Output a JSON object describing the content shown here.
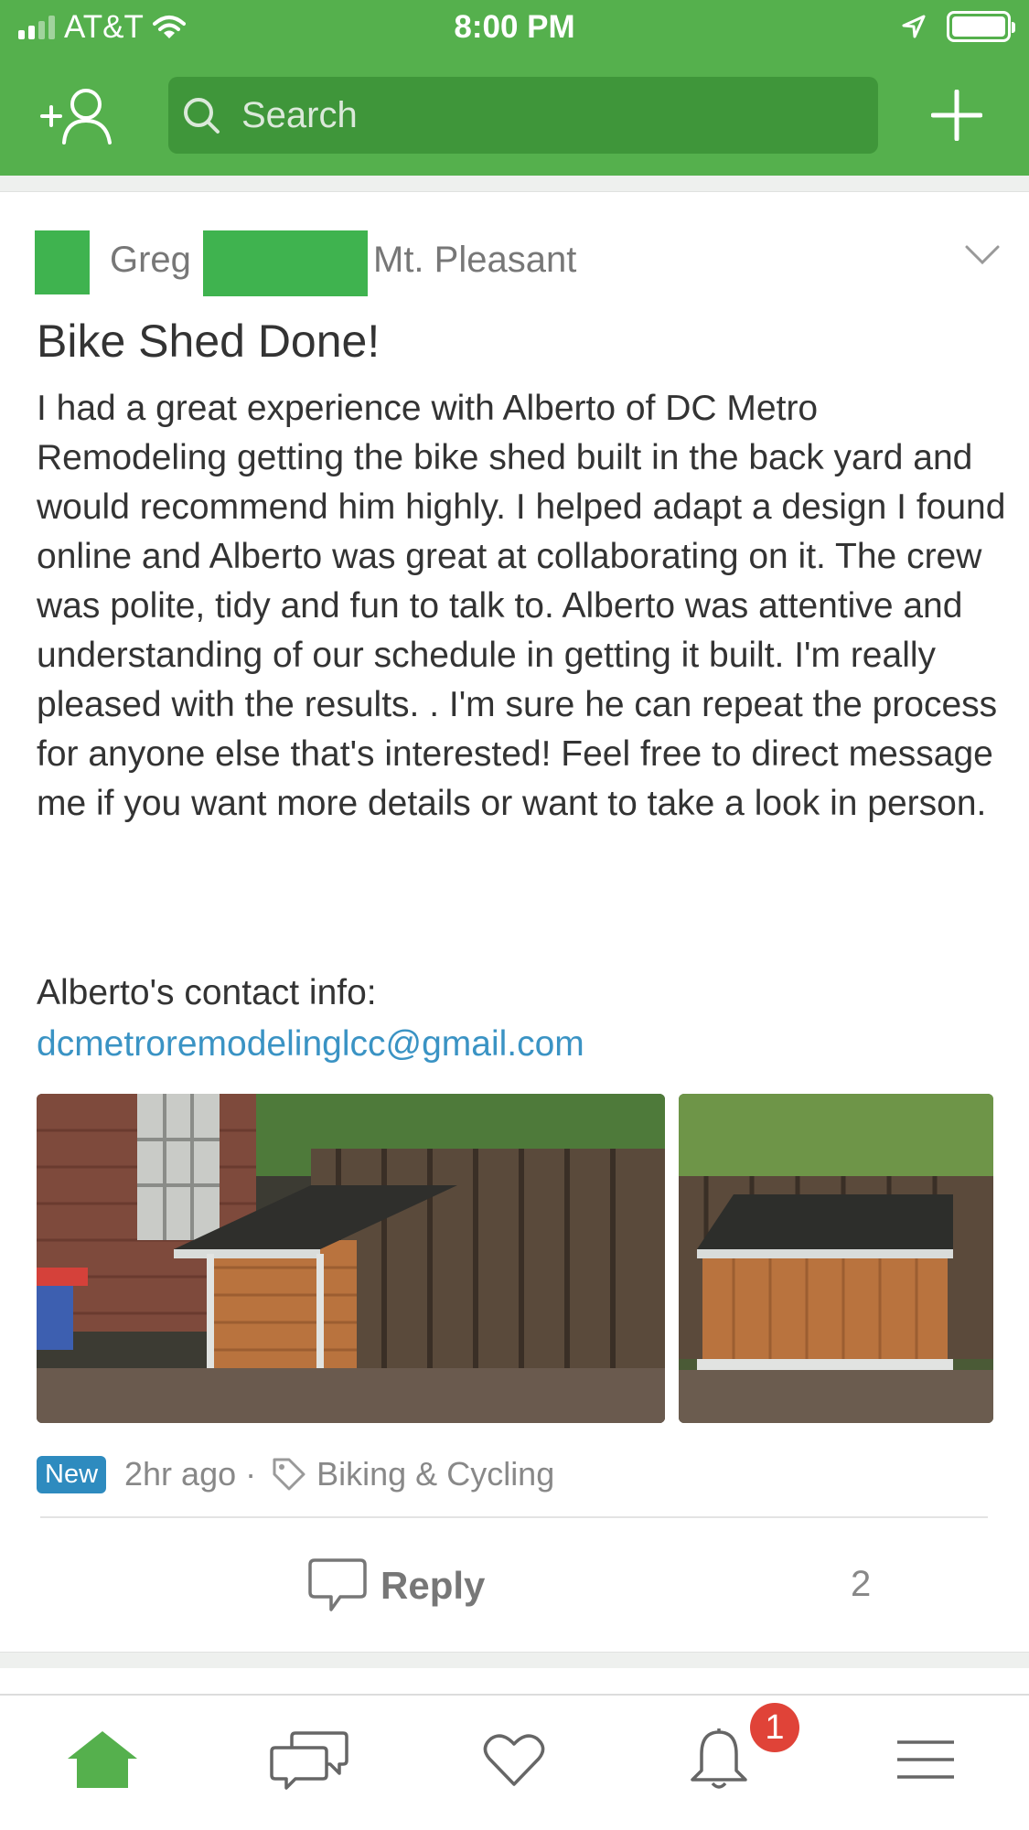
{
  "status_bar": {
    "carrier": "AT&T",
    "time": "8:00 PM"
  },
  "header": {
    "search_placeholder": "Search",
    "icons": [
      "add-neighbor-icon",
      "search-icon",
      "plus-icon"
    ],
    "color": "#55b04d"
  },
  "post": {
    "author_first_name": "Greg",
    "neighborhood": "Mt. Pleasant",
    "title": "Bike Shed Done!",
    "body": "I had a great experience with Alberto of DC Metro Remodeling getting the bike shed built in the back yard and would recommend him highly. I helped adapt a design I found online and Alberto was great at collaborating on it. The crew was polite, tidy and fun to talk to. Alberto was attentive and understanding of our schedule in getting it built. I'm really pleased with the results. . I'm sure he can repeat the process for anyone else that's interested! Feel free to direct message me if you want more details or want to take a look in person.",
    "contact_label": "Alberto's contact info:",
    "contact_email": "dcmetroremodelinglcc@gmail.com",
    "photos": [
      "bike-shed-photo-1",
      "bike-shed-photo-2"
    ],
    "badge": "New",
    "time_ago": "2hr ago",
    "separator": "·",
    "category": "Biking & Cycling",
    "reply_label": "Reply",
    "reply_count": "2"
  },
  "tab_bar": {
    "tabs": [
      "home-icon",
      "messages-icon",
      "heart-icon",
      "bell-icon",
      "menu-icon"
    ],
    "notification_count": "1",
    "active_color": "#55b04d"
  }
}
